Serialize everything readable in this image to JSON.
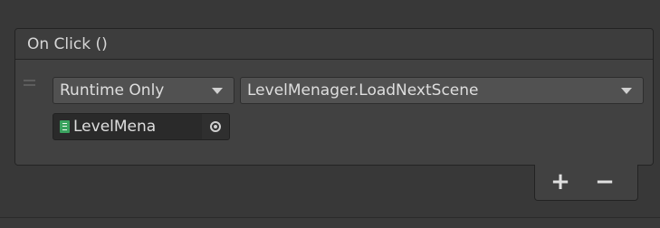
{
  "event": {
    "title": "On Click ()"
  },
  "listener": {
    "call_mode": "Runtime Only",
    "function": "LevelMenager.LoadNextScene",
    "target_object": "LevelMena",
    "target_icon": "script-icon"
  },
  "footer": {
    "add_label": "+",
    "remove_label": "−"
  },
  "colors": {
    "background": "#383838",
    "panel": "#414141",
    "dropdown": "#515151",
    "object_field": "#2a2a2a",
    "script_icon": "#3aa35f"
  }
}
